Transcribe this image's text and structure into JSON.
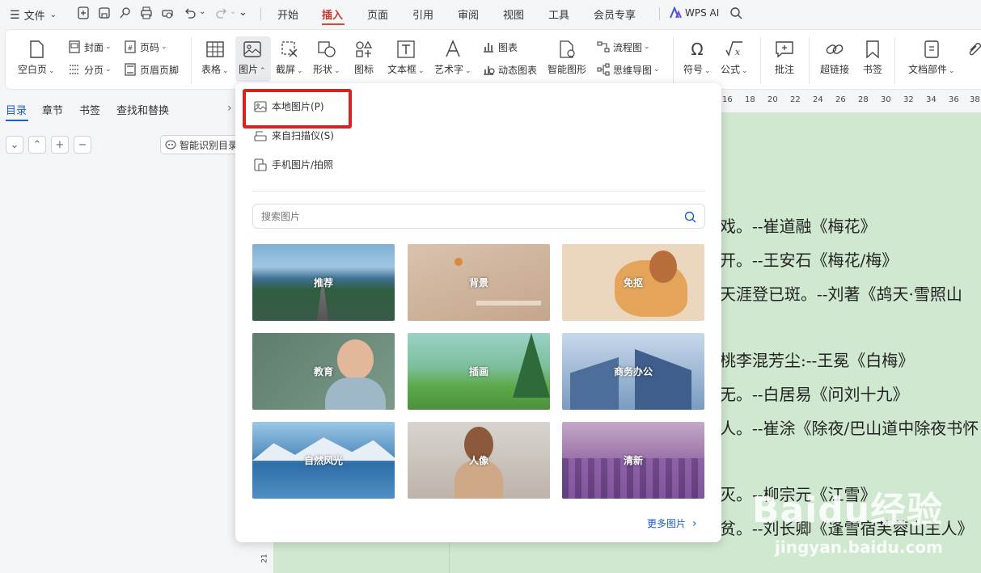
{
  "titlebar": {
    "file_menu": "文件",
    "tabs": [
      "开始",
      "插入",
      "页面",
      "引用",
      "审阅",
      "视图",
      "工具",
      "会员专享"
    ],
    "ai_label": "WPS AI"
  },
  "ribbon": {
    "blank_page": "空白页",
    "cover": "封面",
    "page_break": "分页",
    "page_number": "页码",
    "header_footer": "页眉页脚",
    "table": "表格",
    "picture": "图片",
    "screenshot": "截屏",
    "shape": "形状",
    "icon": "图标",
    "textbox": "文本框",
    "wordart": "艺术字",
    "chart": "图表",
    "dynamic_chart": "动态图表",
    "smart_shape": "智能图形",
    "flowchart": "流程图",
    "mindmap": "思维导图",
    "symbol": "符号",
    "formula": "公式",
    "comment": "批注",
    "hyperlink": "超链接",
    "bookmark": "书签",
    "doc_parts": "文档部件"
  },
  "left_panel": {
    "tabs": [
      "目录",
      "章节",
      "书签",
      "查找和替换"
    ],
    "smart_toc_button": "智能识别目录"
  },
  "ruler": {
    "numbers": [
      "16",
      "18",
      "20",
      "22",
      "24",
      "26",
      "28",
      "30",
      "32",
      "34",
      "36",
      "38"
    ],
    "vertical_number": "21"
  },
  "document": {
    "lines": [
      "戏。--崔道融《梅花》",
      "开。--王安石《梅花/梅》",
      "天涯登已斑。--刘著《鸪天·雪照山",
      "桃李混芳尘:--王冕《白梅》",
      "无。--白居易《问刘十九》",
      "人。--崔涂《除夜/巴山道中除夜书怀",
      "灭。--柳宗元《江雪》",
      "贫。--刘长卿《逢雪宿芙蓉山主人》"
    ]
  },
  "dropdown": {
    "local_picture": "本地图片(P)",
    "scanner": "来自扫描仪(S)",
    "phone_picture": "手机图片/拍照",
    "search_placeholder": "搜索图片",
    "categories": [
      "推荐",
      "背景",
      "免抠",
      "教育",
      "插画",
      "商务办公",
      "自然风光",
      "人像",
      "清新"
    ],
    "more": "更多图片"
  },
  "watermark": {
    "brand": "Baidu经验",
    "url": "jingyan.baidu.com"
  },
  "colors": {
    "active_tab": "#c0392b",
    "highlight_box": "#e01f1f",
    "link_blue": "#1d5fbf",
    "doc_background": "#cfe8cf"
  }
}
